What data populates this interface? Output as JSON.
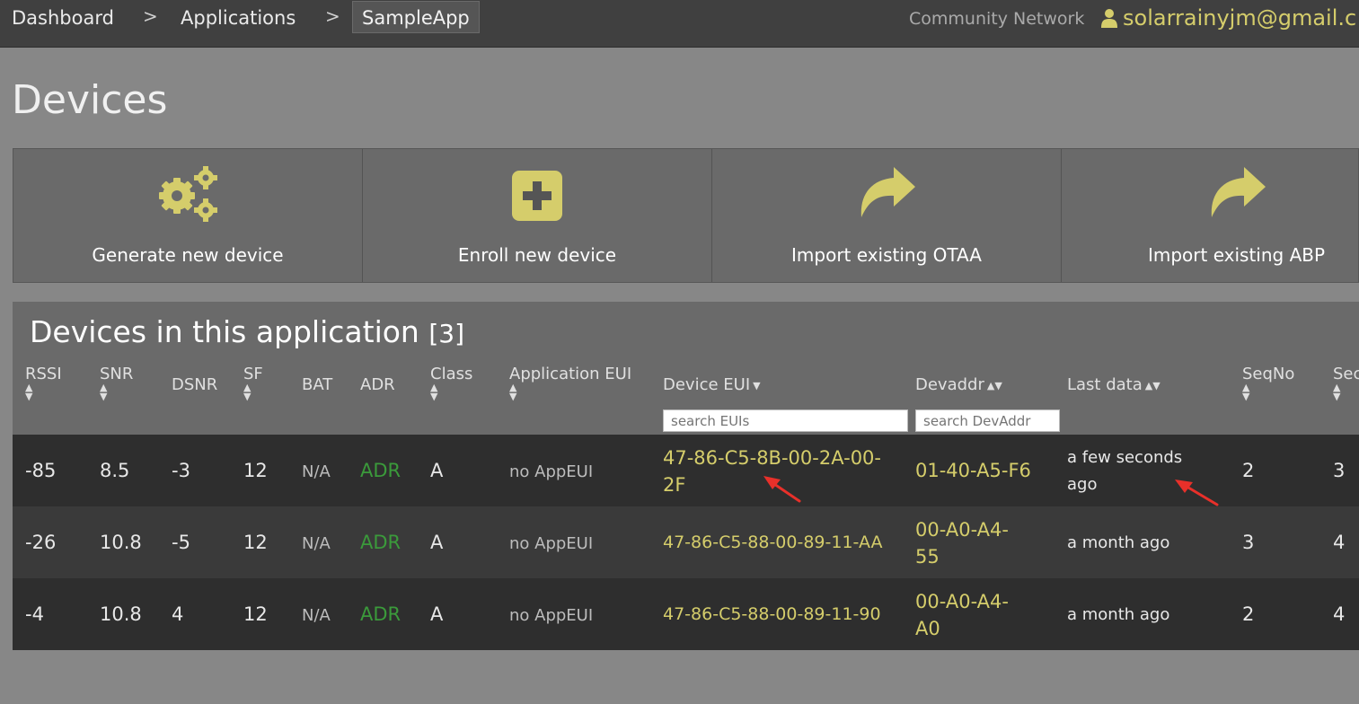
{
  "breadcrumb": {
    "items": [
      "Dashboard",
      "Applications",
      "SampleApp"
    ],
    "separator": ">"
  },
  "header": {
    "network": "Community Network",
    "user_email": "solarrainyjm@gmail.c"
  },
  "page": {
    "title": "Devices"
  },
  "actions": [
    {
      "label": "Generate new device",
      "icon": "gears-icon"
    },
    {
      "label": "Enroll new device",
      "icon": "plus-square-icon"
    },
    {
      "label": "Import existing OTAA",
      "icon": "share-arrow-icon"
    },
    {
      "label": "Import existing ABP",
      "icon": "share-arrow-icon"
    }
  ],
  "devices_panel": {
    "title": "Devices in this application",
    "count": "[3]",
    "columns": [
      "RSSI",
      "SNR",
      "DSNR",
      "SF",
      "BAT",
      "ADR",
      "Class",
      "Application EUI",
      "Device EUI",
      "Devaddr",
      "Last data",
      "SeqNo",
      "Sec"
    ],
    "search_eui_placeholder": "search EUIs",
    "search_devaddr_placeholder": "search DevAddr",
    "rows": [
      {
        "rssi": "-85",
        "snr": "8.5",
        "dsnr": "-3",
        "sf": "12",
        "bat": "N/A",
        "adr": "ADR",
        "class": "A",
        "app_eui": "no AppEUI",
        "dev_eui": "47-86-C5-8B-00-2A-00-2F",
        "devaddr": "01-40-A5-F6",
        "last_data": "a few seconds ago",
        "seqno": "2",
        "sec": "3"
      },
      {
        "rssi": "-26",
        "snr": "10.8",
        "dsnr": "-5",
        "sf": "12",
        "bat": "N/A",
        "adr": "ADR",
        "class": "A",
        "app_eui": "no AppEUI",
        "dev_eui": "47-86-C5-88-00-89-11-AA",
        "devaddr": "00-A0-A4-55",
        "last_data": "a month ago",
        "seqno": "3",
        "sec": "4"
      },
      {
        "rssi": "-4",
        "snr": "10.8",
        "dsnr": "4",
        "sf": "12",
        "bat": "N/A",
        "adr": "ADR",
        "class": "A",
        "app_eui": "no AppEUI",
        "dev_eui": "47-86-C5-88-00-89-11-90",
        "devaddr": "00-A0-A4-A0",
        "last_data": "a month ago",
        "seqno": "2",
        "sec": "4"
      }
    ]
  },
  "colors": {
    "accent": "#d5cd6b",
    "adr_green": "#3b9a3b",
    "annotation_red": "#e8302a"
  }
}
